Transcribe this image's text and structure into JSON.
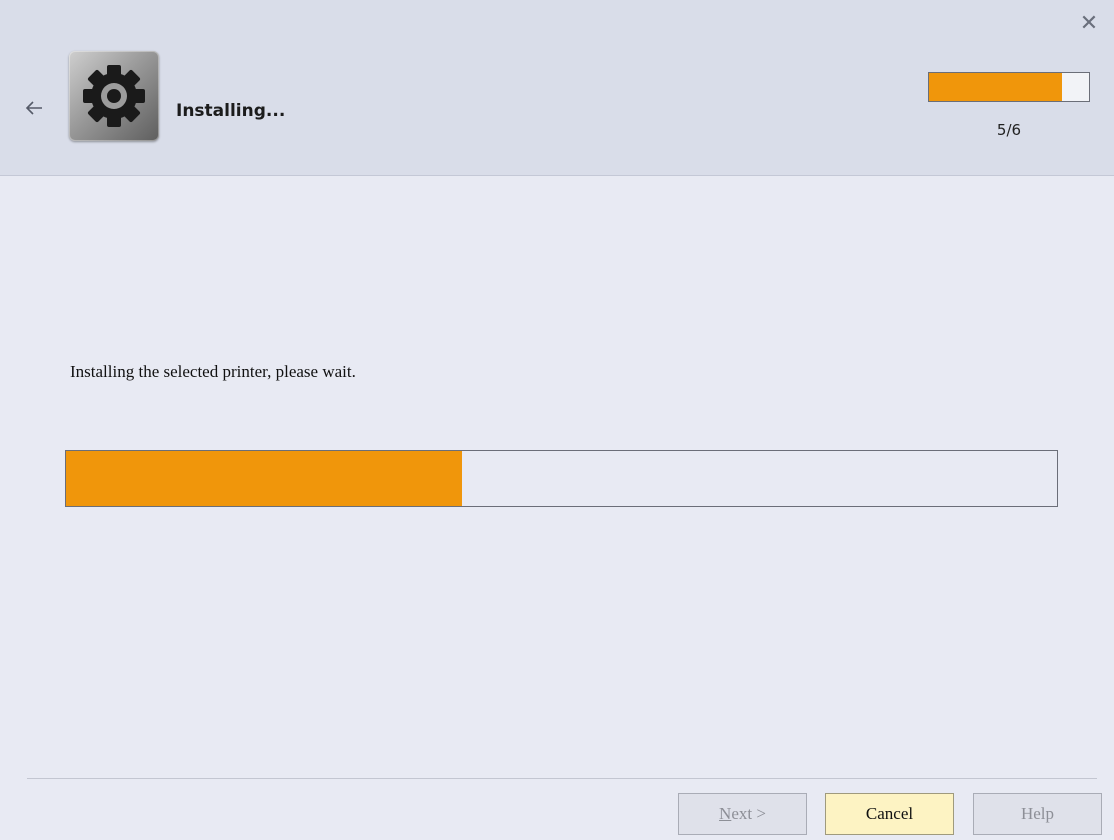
{
  "header": {
    "title": "Installing...",
    "step": {
      "current": 5,
      "total": 6,
      "label": "5/6",
      "progress_fraction": 0.8333
    },
    "icon": "gear-icon",
    "close_icon": "close-icon",
    "back_icon": "back-arrow-icon"
  },
  "main": {
    "status_text": "Installing the selected printer, please wait.",
    "install_progress_fraction": 0.4
  },
  "footer": {
    "next_mnemonic": "N",
    "next_rest": "ext >",
    "cancel_label": "Cancel",
    "help_label": "Help"
  },
  "colors": {
    "accent": "#f0960b",
    "header_bg": "#d9dde9",
    "body_bg": "#e8eaf3",
    "cancel_bg": "#fdf3c3"
  }
}
